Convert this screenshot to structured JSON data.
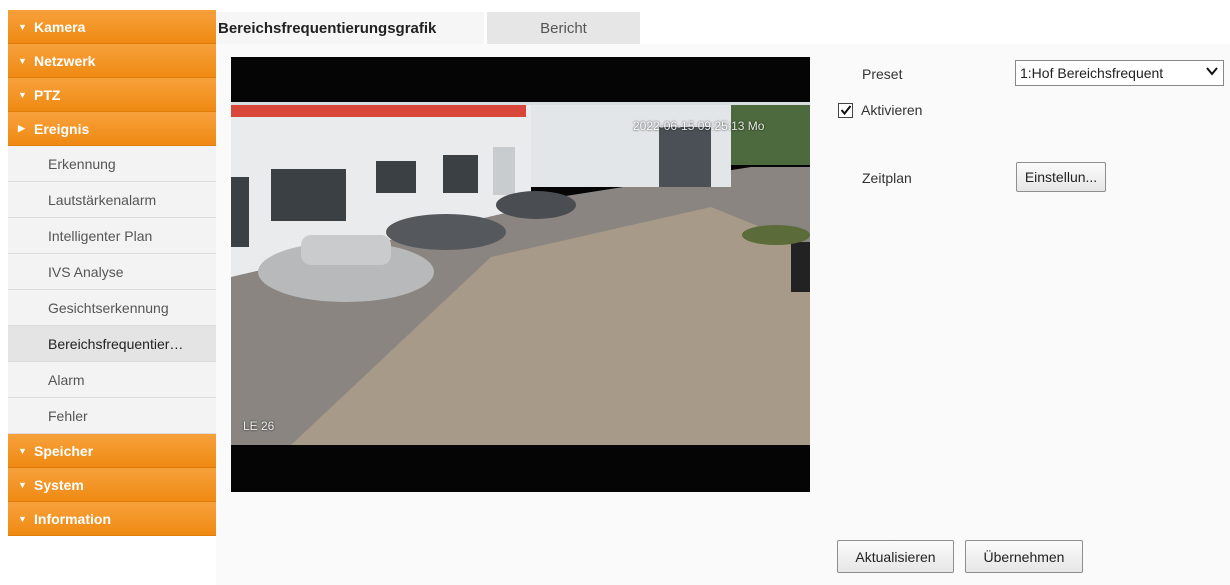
{
  "sidebar": {
    "sections_top": [
      {
        "label": "Kamera",
        "expanded": false
      },
      {
        "label": "Netzwerk",
        "expanded": false
      },
      {
        "label": "PTZ",
        "expanded": false
      },
      {
        "label": "Ereignis",
        "expanded": true
      }
    ],
    "ereignis_items": [
      "Erkennung",
      "Lautstärkenalarm",
      "Intelligenter Plan",
      "IVS Analyse",
      "Gesichtserkennung",
      "Bereichsfrequentier…",
      "Alarm",
      "Fehler"
    ],
    "active_item_index": 5,
    "sections_bottom": [
      {
        "label": "Speicher"
      },
      {
        "label": "System"
      },
      {
        "label": "Information"
      }
    ]
  },
  "tabs": {
    "graph": "Bereichsfrequentierungsgrafik",
    "report": "Bericht"
  },
  "video": {
    "timestamp_osd": "2022-06-15 09:25:13 Mo",
    "camera_name_osd": "LE 26"
  },
  "settings": {
    "preset_label": "Preset",
    "preset_value": "1:Hof Bereichsfrequent",
    "enable_label": "Aktivieren",
    "enable_checked": true,
    "schedule_label": "Zeitplan",
    "schedule_button": "Einstellun..."
  },
  "actions": {
    "refresh": "Aktualisieren",
    "apply": "Übernehmen"
  },
  "colors": {
    "menu_orange": "#ef8a12",
    "menu_orange_light": "#f7a13c"
  }
}
